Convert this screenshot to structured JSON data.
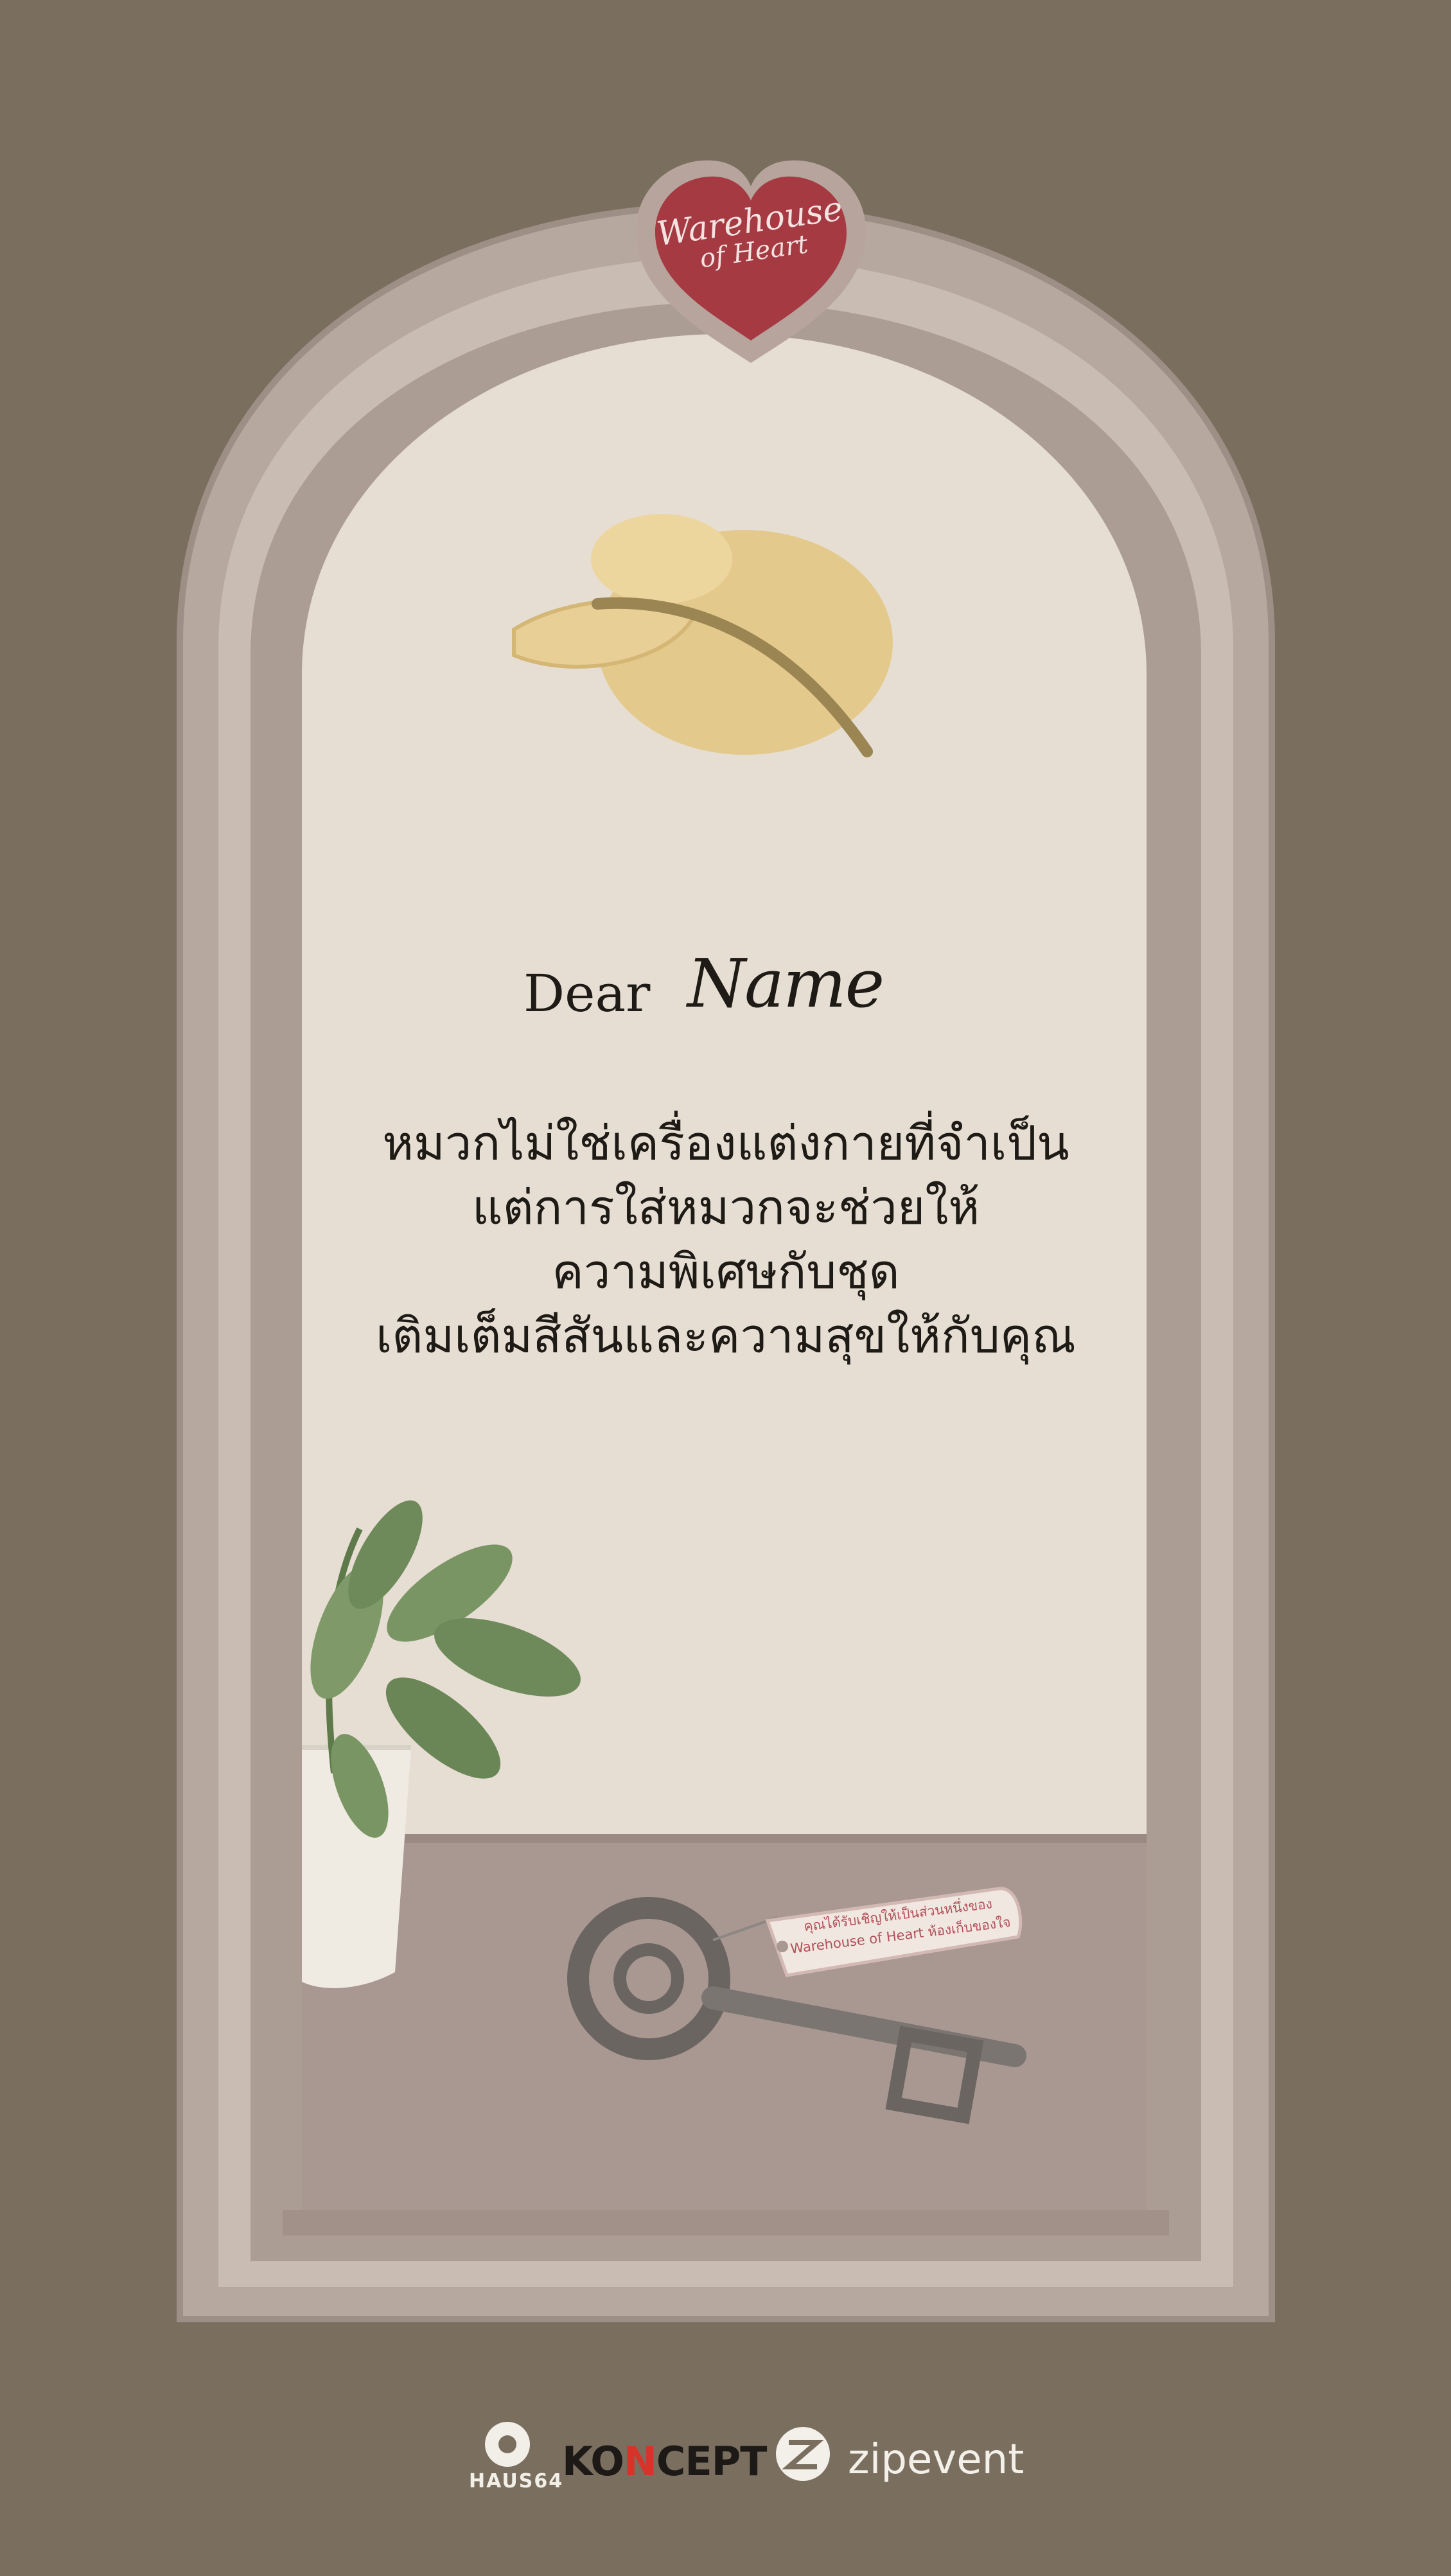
{
  "card": {
    "greeting": "Dear",
    "recipient_name": "Name",
    "message_lines": [
      "หมวกไม่ใช่เครื่องแต่งกายที่จำเป็น",
      "แต่การใส่หมวกจะช่วยให้",
      "ความพิเศษกับชุด",
      "เติมเต็มสีสันและความสุขให้กับคุณ"
    ]
  },
  "heart_badge": {
    "line1": "Warehouse",
    "line2": "of Heart"
  },
  "key_tag": {
    "line1": "คุณได้รับเชิญให้เป็นส่วนหนึ่งของ",
    "line2": "Warehouse of Heart ห้องเก็บของใจ"
  },
  "sponsors": {
    "haus": "HAUS64",
    "koncept_prefix": "KO",
    "koncept_accent": "N",
    "koncept_suffix": "CEPT",
    "zip": "zipevent"
  },
  "colors": {
    "background": "#7a6f5f",
    "frame": "#b6a89f",
    "window": "#e6ded2",
    "sill": "#a99892",
    "heart": "#a63a42",
    "hat": "#e2c58a",
    "leaf": "#6f8a5a"
  },
  "icons": [
    "heart-badge-icon",
    "hat-illustration-icon",
    "plant-illustration-icon",
    "key-illustration-icon",
    "haus64-logo-icon",
    "zipevent-logo-icon"
  ]
}
